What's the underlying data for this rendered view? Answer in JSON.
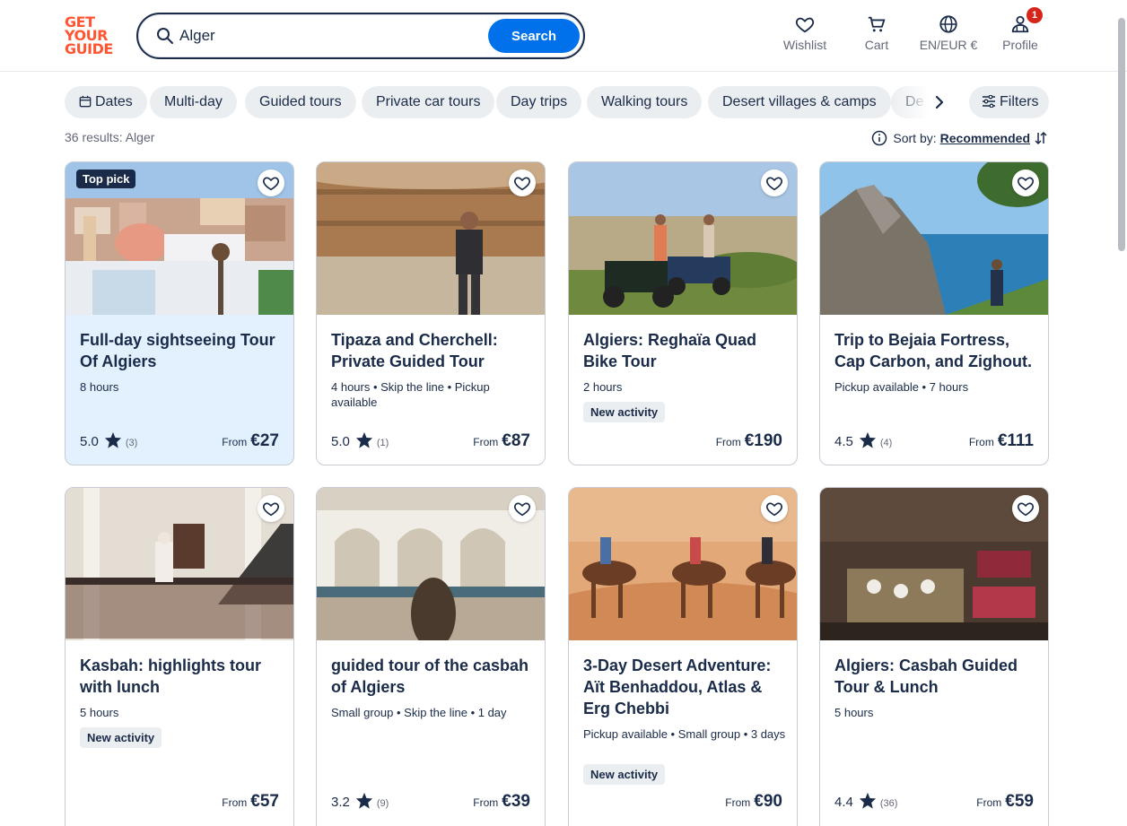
{
  "header": {
    "logo_lines": [
      "GET",
      "YOUR",
      "GUIDE"
    ],
    "search_value": "Alger",
    "search_button": "Search",
    "nav": [
      {
        "label": "Wishlist",
        "icon": "heart-icon"
      },
      {
        "label": "Cart",
        "icon": "cart-icon"
      },
      {
        "label": "EN/EUR €",
        "icon": "globe-icon"
      },
      {
        "label": "Profile",
        "icon": "profile-icon",
        "badge": "1"
      }
    ]
  },
  "chips": [
    "Dates",
    "Multi-day",
    "Guided tours",
    "Private car tours",
    "Day trips",
    "Walking tours",
    "Desert villages & camps",
    "De"
  ],
  "filters_label": "Filters",
  "results_text": "36 results: Alger",
  "sort": {
    "label": "Sort by:",
    "value": "Recommended"
  },
  "cards": [
    {
      "title": "Full-day sightseeing Tour Of Algiers",
      "meta": "8 hours",
      "new": "",
      "rating": "5.0",
      "reviews": "(3)",
      "from": "From",
      "price": "€27",
      "top_pick": "Top pick",
      "highlight": true,
      "image": "Algiers white buildings and domes"
    },
    {
      "title": "Tipaza and Cherchell: Private Guided Tour",
      "meta": "4 hours • Skip the line • Pickup available",
      "new": "",
      "rating": "5.0",
      "reviews": "(1)",
      "from": "From",
      "price": "€87",
      "image": "Man at Roman mausoleum"
    },
    {
      "title": "Algiers: Reghaïa Quad Bike Tour",
      "meta": "2 hours",
      "new": "New activity",
      "rating": "",
      "reviews": "",
      "from": "From",
      "price": "€190",
      "image": "Quad bikes in fields"
    },
    {
      "title": "Trip to Bejaia Fortress, Cap Carbon, and Zighout.",
      "meta": "Pickup available • 7 hours",
      "new": "",
      "rating": "4.5",
      "reviews": "(4)",
      "from": "From",
      "price": "€111",
      "image": "Coastal cliffs over sea"
    },
    {
      "title": "Kasbah: highlights tour with lunch",
      "meta": "5 hours",
      "new": "New activity",
      "rating": "",
      "reviews": "",
      "from": "From",
      "price": "€57",
      "image": "Traditional Kasbah courtyard"
    },
    {
      "title": "guided tour of the casbah of Algiers",
      "meta": "Small group • Skip the line • 1 day",
      "new": "",
      "rating": "3.2",
      "reviews": "(9)",
      "from": "From",
      "price": "€39",
      "image": "Moorish arches palace"
    },
    {
      "title": "3-Day Desert Adventure: Aït Benhaddou, Atlas & Erg Chebbi",
      "meta": "Pickup available • Small group • 3 days",
      "new": "New activity",
      "rating": "",
      "reviews": "",
      "from": "From",
      "price": "€90",
      "image": "Camel caravan in desert"
    },
    {
      "title": "Algiers: Casbah Guided Tour & Lunch",
      "meta": "5 hours",
      "new": "",
      "rating": "4.4",
      "reviews": "(36)",
      "from": "From",
      "price": "€59",
      "image": "Traditional restaurant interior"
    }
  ],
  "colors": {
    "brand": "#ff5533",
    "accent": "#0071eb",
    "text": "#1a2b49",
    "highlight_card": "#e3f1ff"
  }
}
